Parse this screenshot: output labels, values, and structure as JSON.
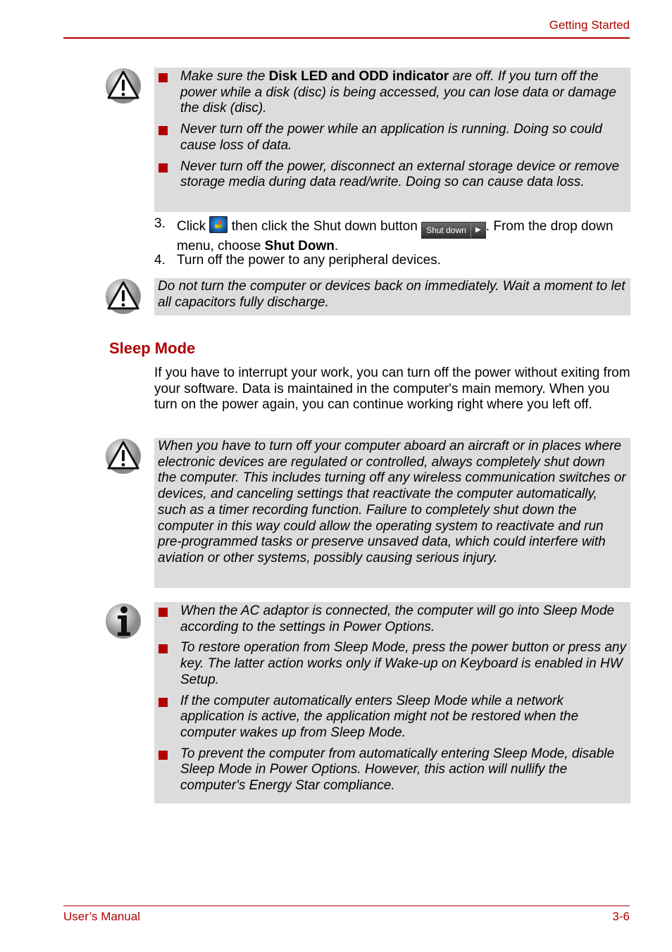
{
  "header": {
    "section": "Getting Started"
  },
  "footer": {
    "left": "User’s Manual",
    "right": "3-6"
  },
  "colors": {
    "accent": "#b00000",
    "note_bg": "#dcdcdc"
  },
  "caution1": {
    "icon": "warning-icon",
    "items": [
      {
        "pre": "Make sure the ",
        "bold": "Disk LED and ODD indicator",
        "post": " are off. If you turn off the power while a disk (disc) is being accessed, you can lose data or damage the disk (disc)."
      },
      {
        "text": "Never turn off the power while an application is running. Doing so could cause loss of data."
      },
      {
        "text": "Never turn off the power, disconnect an external storage device or remove storage media during data read/write. Doing so can cause data loss."
      }
    ]
  },
  "steps": [
    {
      "num": "3.",
      "a": "Click ",
      "b": " then click the Shut down button ",
      "c": ". From the drop down menu, choose ",
      "bold": "Shut Down",
      "d": ".",
      "shutdown_button_label": "Shut down",
      "start_icon": "windows-start-icon"
    },
    {
      "num": "4.",
      "text": "Turn off the power to any peripheral devices."
    }
  ],
  "caution2": {
    "icon": "warning-icon",
    "text": "Do not turn the computer or devices back on immediately. Wait a moment to let all capacitors fully discharge."
  },
  "sleep": {
    "heading": "Sleep Mode",
    "paragraph": "If you have to interrupt your work, you can turn off the power without exiting from your software. Data is maintained in the computer's main memory. When you turn on the power again, you can continue working right where you left off."
  },
  "caution3": {
    "icon": "warning-icon",
    "text": "When you have to turn off your computer aboard an aircraft or in places where electronic devices are regulated or controlled, always completely shut down the computer. This includes turning off any wireless communication switches or devices, and canceling settings that reactivate the computer automatically, such as a timer recording function. Failure to completely shut down the computer in this way could allow the operating system to reactivate and run pre-programmed tasks or preserve unsaved data, which could interfere with aviation or other systems, possibly causing serious injury."
  },
  "info": {
    "icon": "info-icon",
    "items": [
      "When the AC adaptor is connected, the computer will go into Sleep Mode according to the settings in Power Options.",
      "To restore operation from Sleep Mode, press the power button or press any key. The latter action works only if Wake-up on Keyboard is enabled in HW Setup.",
      "If the computer automatically enters Sleep Mode while a network application is active, the application might not be restored when the computer wakes up from Sleep Mode.",
      "To prevent the computer from automatically entering Sleep Mode, disable Sleep Mode in Power Options. However, this action will nullify the computer's Energy Star compliance."
    ]
  }
}
